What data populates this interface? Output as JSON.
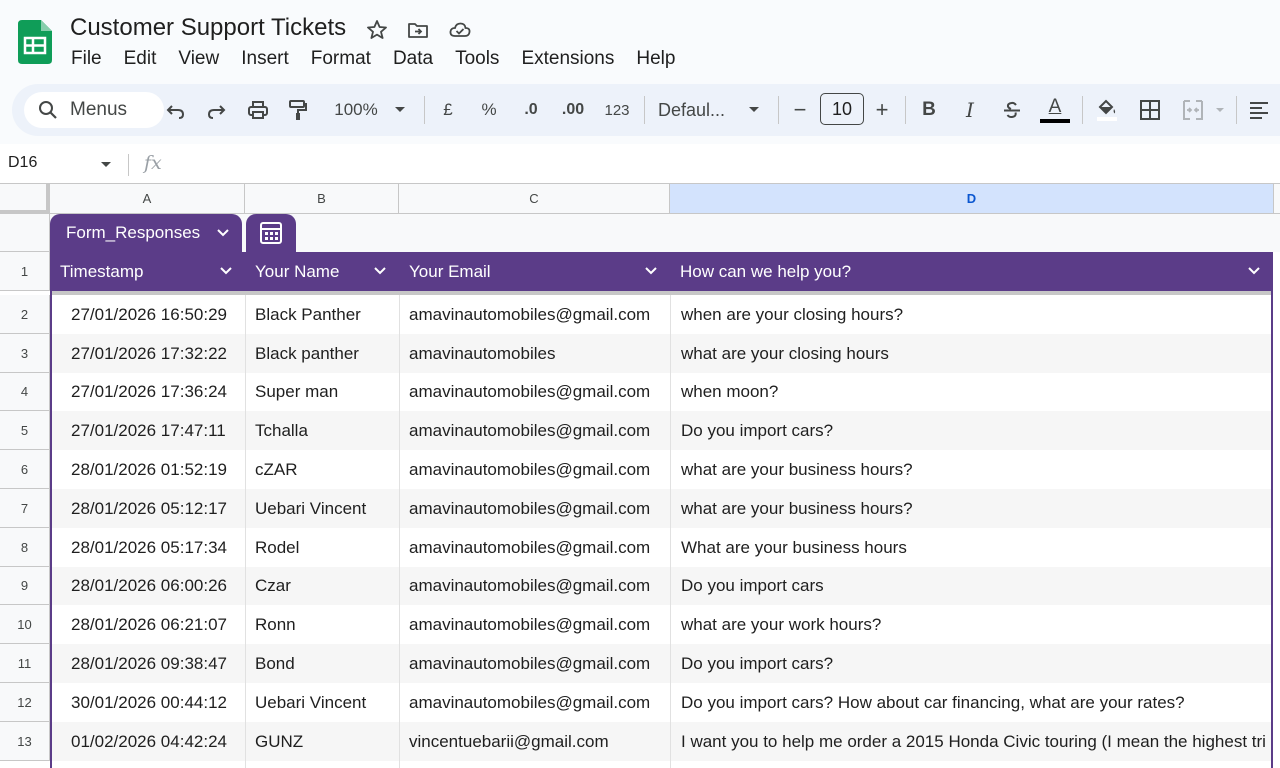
{
  "doc": {
    "title": "Customer Support Tickets"
  },
  "menu": [
    "File",
    "Edit",
    "View",
    "Insert",
    "Format",
    "Data",
    "Tools",
    "Extensions",
    "Help"
  ],
  "toolbar": {
    "search_label": "Menus",
    "zoom": "100%",
    "currency": "£",
    "percent": "%",
    "decrease_decimal": ".0",
    "increase_decimal": ".00",
    "number_format": "123",
    "font": "Defaul...",
    "font_size": "10",
    "minus": "−",
    "plus": "+",
    "bold": "B",
    "italic": "I",
    "text_color_letter": "A"
  },
  "formula_bar": {
    "cell_ref": "D16",
    "fx": "fx"
  },
  "columns": [
    "A",
    "B",
    "C",
    "D"
  ],
  "table": {
    "name": "Form_Responses",
    "headers": [
      "Timestamp",
      "Your Name",
      "Your Email",
      "How can we help you?"
    ],
    "rows": [
      {
        "n": "1"
      },
      {
        "n": "2",
        "cells": [
          "27/01/2026 16:50:29",
          "Black Panther",
          "amavinautomobiles@gmail.com",
          "when are your closing hours?"
        ]
      },
      {
        "n": "3",
        "cells": [
          "27/01/2026 17:32:22",
          "Black panther",
          "amavinautomobiles",
          "what are your closing hours"
        ]
      },
      {
        "n": "4",
        "cells": [
          "27/01/2026 17:36:24",
          "Super man",
          "amavinautomobiles@gmail.com",
          "when moon?"
        ]
      },
      {
        "n": "5",
        "cells": [
          "27/01/2026 17:47:11",
          "Tchalla",
          "amavinautomobiles@gmail.com",
          "Do you import cars?"
        ]
      },
      {
        "n": "6",
        "cells": [
          "28/01/2026 01:52:19",
          "cZAR",
          "amavinautomobiles@gmail.com",
          "what are your business hours?"
        ]
      },
      {
        "n": "7",
        "cells": [
          "28/01/2026 05:12:17",
          "Uebari Vincent",
          "amavinautomobiles@gmail.com",
          "what are your business hours?"
        ]
      },
      {
        "n": "8",
        "cells": [
          "28/01/2026 05:17:34",
          "Rodel",
          "amavinautomobiles@gmail.com",
          "What are your business hours"
        ]
      },
      {
        "n": "9",
        "cells": [
          "28/01/2026 06:00:26",
          "Czar",
          "amavinautomobiles@gmail.com",
          "Do you import cars"
        ]
      },
      {
        "n": "10",
        "cells": [
          "28/01/2026 06:21:07",
          "Ronn",
          "amavinautomobiles@gmail.com",
          "what are your work hours?"
        ]
      },
      {
        "n": "11",
        "cells": [
          "28/01/2026 09:38:47",
          "Bond",
          "amavinautomobiles@gmail.com",
          "Do you import cars?"
        ]
      },
      {
        "n": "12",
        "cells": [
          "30/01/2026 00:44:12",
          "Uebari Vincent",
          "amavinautomobiles@gmail.com",
          "Do you import cars? How about car financing, what are your rates?"
        ]
      },
      {
        "n": "13",
        "cells": [
          "01/02/2026 04:42:24",
          "GUNZ",
          "vincentuebarii@gmail.com",
          "I want you to help me order a 2015 Honda Civic touring (I mean the highest tri"
        ]
      }
    ]
  },
  "colors": {
    "table_header": "#5b3c88",
    "sheets_green": "#0f9d58",
    "selected_col": "#d3e3fd"
  }
}
